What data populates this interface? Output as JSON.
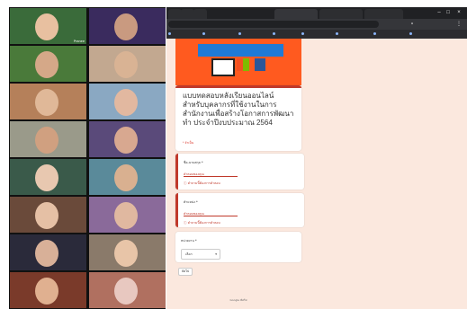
{
  "colors": {
    "accent": "#c0392b",
    "banner": "#ff5a1f",
    "page_bg": "#fbe8de"
  },
  "grid": {
    "tiles": [
      {
        "name": "Pranee",
        "bg": "#3a6b3a",
        "face": "#e8c0a0"
      },
      {
        "name": "",
        "bg": "#3a2b5e",
        "face": "#c99a80"
      },
      {
        "name": "",
        "bg": "#4a7a3a",
        "face": "#d5a888"
      },
      {
        "name": "",
        "bg": "#c2a890",
        "face": "#d9b394"
      },
      {
        "name": "",
        "bg": "#b5805a",
        "face": "#e0b898"
      },
      {
        "name": "",
        "bg": "#8aa8c2",
        "face": "#e2b8a0"
      },
      {
        "name": "",
        "bg": "#9a9a8a",
        "face": "#d0a080"
      },
      {
        "name": "",
        "bg": "#5a4a7a",
        "face": "#d8a890"
      },
      {
        "name": "",
        "bg": "#3a5a4a",
        "face": "#e8c8b0"
      },
      {
        "name": "",
        "bg": "#5a8a9a",
        "face": "#d9b090"
      },
      {
        "name": "",
        "bg": "#6a4a3a",
        "face": "#e5c0a5"
      },
      {
        "name": "",
        "bg": "#8a6a9a",
        "face": "#e0b8a0"
      },
      {
        "name": "",
        "bg": "#2a2a3a",
        "face": "#d8b098"
      },
      {
        "name": "",
        "bg": "#8a7a6a",
        "face": "#e8c5a8"
      },
      {
        "name": "",
        "bg": "#7a3a2a",
        "face": "#e0b090"
      },
      {
        "name": "",
        "bg": "#b07060",
        "face": "#e8c8c0"
      }
    ]
  },
  "browser": {
    "tabs": [
      "",
      "",
      "",
      "",
      "",
      ""
    ],
    "url": "",
    "bookmarks": [
      "",
      "",
      "",
      "",
      "",
      "",
      "",
      ""
    ]
  },
  "form": {
    "title": "แบบทดสอบหลังเรียนออนไลน์สำหรับบุคลากรที่ใช้งานในการสำนักงานเพื่อสร้างโอกาสการพัฒนาทำ ประจำปีงบประมาณ 2564",
    "required_note": "* จำเป็น",
    "questions": [
      {
        "label": "ชื่อ-นามสกุล *",
        "placeholder": "คำตอบของคุณ",
        "error": "คำถามนี้ต้องการคำตอบ"
      },
      {
        "label": "ตำแหน่ง *",
        "placeholder": "คำตอบของคุณ",
        "error": "คำถามนี้ต้องการคำตอบ"
      },
      {
        "label": "หน่วยงาน *",
        "select_value": "เลือก"
      }
    ],
    "next_label": "ถัดไป",
    "footer_note": "Google Forms",
    "brand": "Google ฟอร์ม"
  }
}
